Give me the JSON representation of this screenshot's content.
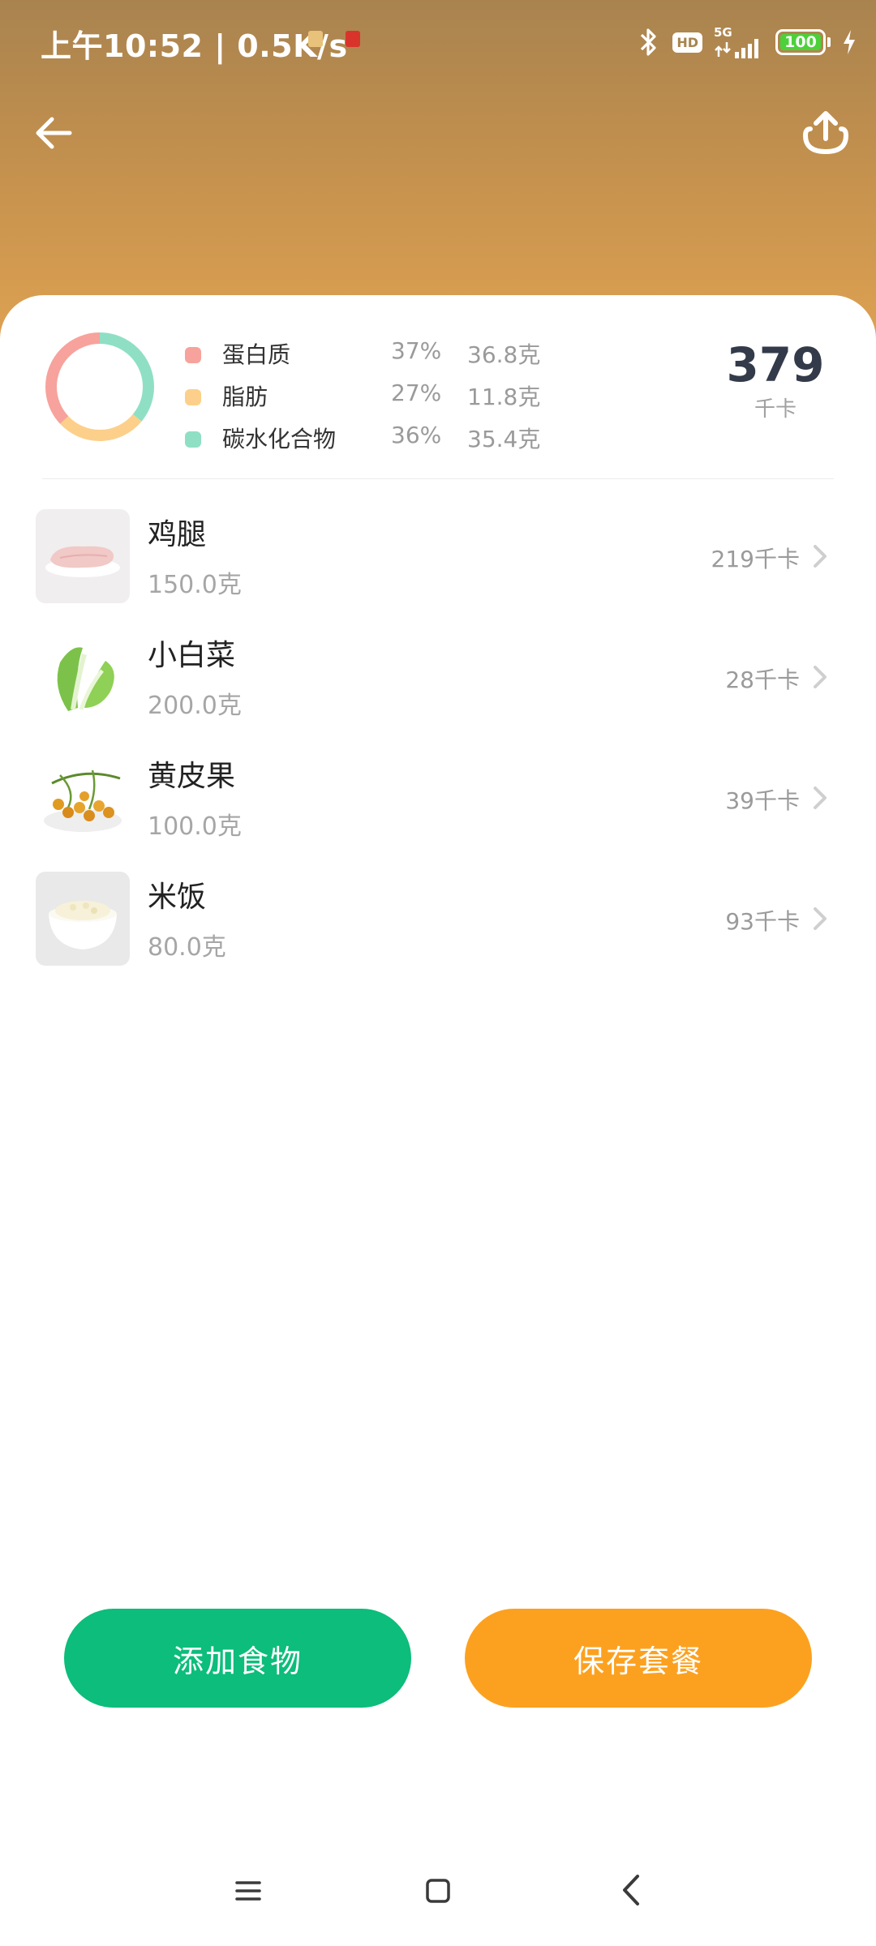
{
  "status_bar": {
    "time_speed": "上午10:52 | 0.5K/s",
    "network": "5G",
    "hd": "HD",
    "battery": "100",
    "battery_level": 1.0
  },
  "nav": {
    "back_icon": "arrow-left-icon",
    "share_icon": "upload-share-icon"
  },
  "summary": {
    "macros": [
      {
        "name": "蛋白质",
        "percent": "37%",
        "amount": "36.8克",
        "color": "#f7a29c"
      },
      {
        "name": "脂肪",
        "percent": "27%",
        "amount": "11.8克",
        "color": "#fcd08a"
      },
      {
        "name": "碳水化合物",
        "percent": "36%",
        "amount": "35.4克",
        "color": "#8fdfc5"
      }
    ],
    "total_kcal": "379",
    "kcal_unit": "千卡"
  },
  "foods": [
    {
      "name": "鸡腿",
      "weight": "150.0克",
      "kcal": "219千卡"
    },
    {
      "name": "小白菜",
      "weight": "200.0克",
      "kcal": "28千卡"
    },
    {
      "name": "黄皮果",
      "weight": "100.0克",
      "kcal": "39千卡"
    },
    {
      "name": "米饭",
      "weight": "80.0克",
      "kcal": "93千卡"
    }
  ],
  "actions": {
    "add_label": "添加食物",
    "save_label": "保存套餐",
    "add_color": "#0cbd7b",
    "save_color": "#fca11f"
  },
  "colors": {
    "header_top": "#a9834f",
    "header_bottom": "#e2a452"
  }
}
